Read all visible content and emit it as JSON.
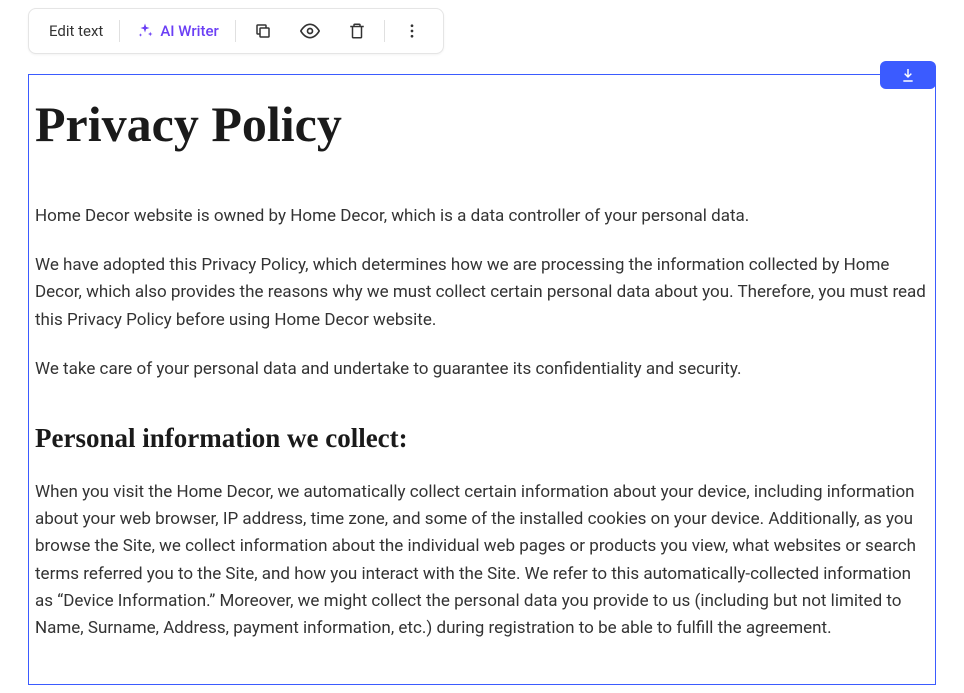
{
  "toolbar": {
    "edit_text": "Edit text",
    "ai_writer": "AI Writer"
  },
  "content": {
    "title": "Privacy Policy",
    "para1": "Home Decor website is owned by Home Decor, which is a data controller of your personal data.",
    "para2": "We have adopted this Privacy Policy, which determines how we are processing the information collected by Home Decor, which also provides the reasons why we must collect certain personal data about you. Therefore, you must read this Privacy Policy before using Home Decor website.",
    "para3": "We take care of your personal data and undertake to guarantee its confidentiality and security.",
    "section1_heading": "Personal information we collect:",
    "section1_body": "When you visit the Home Decor, we automatically collect certain information about your device, including information about your web browser, IP address, time zone, and some of the installed cookies on your device. Additionally, as you browse the Site, we collect information about the individual web pages or products you view, what websites or search terms referred you to the Site, and how you interact with the Site. We refer to this automatically-collected information as “Device Information.” Moreover, we might collect the personal data you provide to us (including but not limited to Name, Surname, Address, payment information, etc.) during registration to be able to fulfill the agreement."
  }
}
